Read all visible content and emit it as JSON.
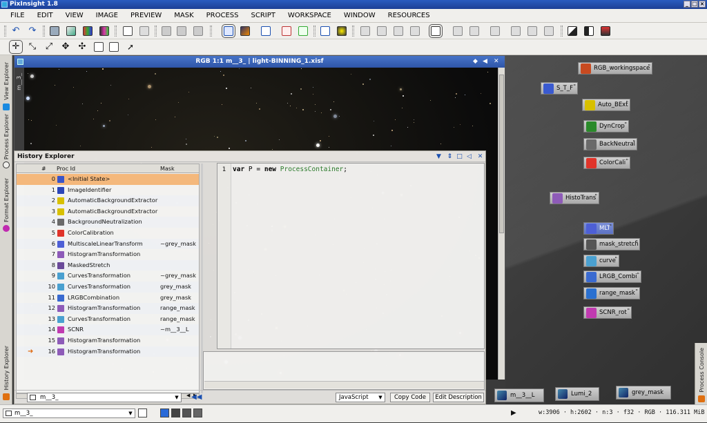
{
  "app": {
    "title": "PixInsight 1.8"
  },
  "menu": [
    "FILE",
    "EDIT",
    "VIEW",
    "IMAGE",
    "PREVIEW",
    "MASK",
    "PROCESS",
    "SCRIPT",
    "WORKSPACE",
    "WINDOW",
    "RESOURCES"
  ],
  "image_window": {
    "title": "RGB 1:1 m__3_ | light-BINNING_1.xisf",
    "side_label": "m__3_"
  },
  "side_tabs": {
    "left": [
      "View Explorer",
      "Process Explorer",
      "Format Explorer",
      "History Explorer"
    ],
    "right": "Process Console"
  },
  "history": {
    "title": "History Explorer",
    "columns": {
      "num": "#",
      "proc": "Proc Id",
      "mask": "Mask"
    },
    "rows": [
      {
        "n": "0",
        "proc": "<Initial State>",
        "mask": "",
        "color": "#3a55c8"
      },
      {
        "n": "1",
        "proc": "ImageIdentifier",
        "mask": "",
        "color": "#2b46b8"
      },
      {
        "n": "2",
        "proc": "AutomaticBackgroundExtractor",
        "mask": "",
        "color": "#d8c000"
      },
      {
        "n": "3",
        "proc": "AutomaticBackgroundExtractor",
        "mask": "",
        "color": "#d8c000"
      },
      {
        "n": "4",
        "proc": "BackgroundNeutralization",
        "mask": "",
        "color": "#6a6a6a"
      },
      {
        "n": "5",
        "proc": "ColorCalibration",
        "mask": "",
        "color": "#e0342a"
      },
      {
        "n": "6",
        "proc": "MultiscaleLinearTransform",
        "mask": "~grey_mask",
        "color": "#4d5fd6"
      },
      {
        "n": "7",
        "proc": "HistogramTransformation",
        "mask": "",
        "color": "#8e5bb8"
      },
      {
        "n": "8",
        "proc": "MaskedStretch",
        "mask": "",
        "color": "#6a4a9a"
      },
      {
        "n": "9",
        "proc": "CurvesTransformation",
        "mask": "~grey_mask",
        "color": "#4aa0d0"
      },
      {
        "n": "10",
        "proc": "CurvesTransformation",
        "mask": "grey_mask",
        "color": "#4aa0d0"
      },
      {
        "n": "11",
        "proc": "LRGBCombination",
        "mask": "grey_mask",
        "color": "#3a6ad0"
      },
      {
        "n": "12",
        "proc": "HistogramTransformation",
        "mask": "range_mask",
        "color": "#8e5bb8"
      },
      {
        "n": "13",
        "proc": "CurvesTransformation",
        "mask": "range_mask",
        "color": "#4aa0d0"
      },
      {
        "n": "14",
        "proc": "SCNR",
        "mask": "~m__3__L",
        "color": "#c03ab0"
      },
      {
        "n": "15",
        "proc": "HistogramTransformation",
        "mask": "",
        "color": "#8e5bb8"
      },
      {
        "n": "16",
        "proc": "HistogramTransformation",
        "mask": "",
        "color": "#8e5bb8"
      }
    ],
    "code_line_number": "1",
    "code": {
      "kw1": "var",
      "ident": "P",
      "eq": "=",
      "kw2": "new",
      "type": "ProcessContainer",
      "end": ";"
    },
    "view_select": "m__3_",
    "language": "JavaScript",
    "copy_code": "Copy Code",
    "edit_description": "Edit Description"
  },
  "process_icons": [
    {
      "label": "RGB_workingspace",
      "color": "#c84a20"
    },
    {
      "label": "S_T_F",
      "color": "#3a5ad0"
    },
    {
      "label": "Auto_BExt",
      "color": "#d8c000"
    },
    {
      "label": "DynCrop",
      "color": "#2a8a2a"
    },
    {
      "label": "BackNeutral",
      "color": "#6a6a6a"
    },
    {
      "label": "ColorCali",
      "color": "#e0342a"
    },
    {
      "label": "HistoTrans",
      "color": "#8e5bb8"
    },
    {
      "label": "MLT",
      "color": "#4d5fd6"
    },
    {
      "label": "mask_stretch",
      "color": "#555"
    },
    {
      "label": "curve",
      "color": "#4aa0d0"
    },
    {
      "label": "LRGB_Combi",
      "color": "#3a6ad0"
    },
    {
      "label": "range_mask",
      "color": "#2a70d0"
    },
    {
      "label": "SCNR_rot",
      "color": "#c03ab0"
    }
  ],
  "image_icons": [
    "m__3__L",
    "Lumi_2",
    "grey_mask"
  ],
  "statusbar": {
    "view": "m__3_",
    "info": "w:3906 · h:2602 · n:3 · f32 · RGB · 116.311 MiB"
  }
}
